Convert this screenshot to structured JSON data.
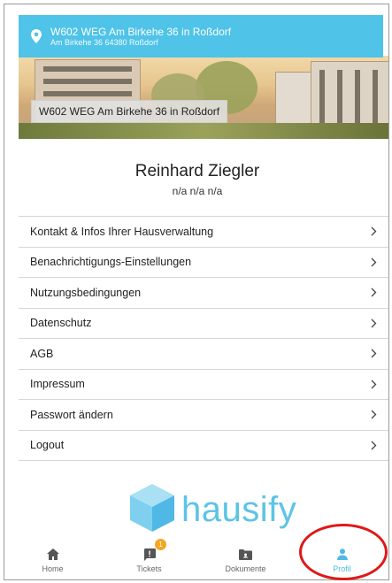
{
  "header": {
    "title": "W602 WEG Am Birkehe 36 in Roßdorf",
    "address": "Am Birkehe 36 64380 Roßdorf",
    "color": "#4fc3e8"
  },
  "hero": {
    "label": "W602 WEG Am Birkehe 36 in Roßdorf"
  },
  "profile": {
    "name": "Reinhard Ziegler",
    "details": "n/a n/a n/a"
  },
  "menu": {
    "items": [
      {
        "label": "Kontakt & Infos Ihrer Hausverwaltung"
      },
      {
        "label": "Benachrichtigungs-Einstellungen"
      },
      {
        "label": "Nutzungsbedingungen"
      },
      {
        "label": "Datenschutz"
      },
      {
        "label": "AGB"
      },
      {
        "label": "Impressum"
      },
      {
        "label": "Passwort ändern"
      },
      {
        "label": "Logout"
      }
    ],
    "chevron_icon": "chevron-right-icon"
  },
  "logo": {
    "text": "hausify",
    "color": "#5cc4e6"
  },
  "nav": {
    "items": [
      {
        "label": "Home",
        "icon": "home-icon"
      },
      {
        "label": "Tickets",
        "icon": "ticket-icon",
        "badge": "1"
      },
      {
        "label": "Dokumente",
        "icon": "folder-icon"
      },
      {
        "label": "Profil",
        "icon": "person-icon",
        "active": true
      }
    ],
    "active_color": "#4fb8e6",
    "badge_color": "#f4a623"
  }
}
